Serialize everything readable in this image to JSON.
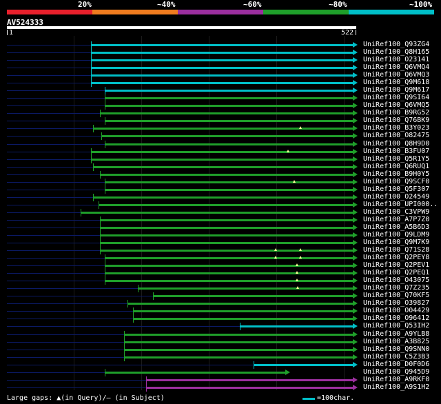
{
  "legend": {
    "labels": [
      "20%",
      "~40%",
      "~60%",
      "~80%",
      "~100%"
    ],
    "colors": [
      "#e8202c",
      "#f07c1f",
      "#9b2f9e",
      "#1f9f2a",
      "#00bfc8"
    ]
  },
  "query": {
    "name": "AV524333",
    "start": "1",
    "end": "522"
  },
  "hits": [
    {
      "name": "UniRef100_Q93ZG4",
      "color": "#00bfc8",
      "gaps": []
    },
    {
      "name": "UniRef100_Q8H165",
      "color": "#00bfc8",
      "gaps": []
    },
    {
      "name": "UniRef100_O23141",
      "color": "#00bfc8",
      "gaps": []
    },
    {
      "name": "UniRef100_Q6VMQ4",
      "color": "#00bfc8",
      "gaps": []
    },
    {
      "name": "UniRef100_Q6VMQ3",
      "color": "#00bfc8",
      "gaps": []
    },
    {
      "name": "UniRef100_Q9M618",
      "color": "#00bfc8",
      "gaps": []
    },
    {
      "name": "UniRef100_Q9M617",
      "color": "#00bfc8",
      "gaps": []
    },
    {
      "name": "UniRef100_Q9SI64",
      "color": "#1f9f2a",
      "gaps": []
    },
    {
      "name": "UniRef100_Q6VMQ5",
      "color": "#1f9f2a",
      "gaps": []
    },
    {
      "name": "UniRef100_B9RG52",
      "color": "#1f9f2a",
      "gaps": []
    },
    {
      "name": "UniRef100_Q76BK9",
      "color": "#1f9f2a",
      "gaps": []
    },
    {
      "name": "UniRef100_B3Y023",
      "color": "#1f9f2a",
      "gaps": [
        436
      ]
    },
    {
      "name": "UniRef100_O82475",
      "color": "#1f9f2a",
      "gaps": []
    },
    {
      "name": "UniRef100_Q8H9D0",
      "color": "#1f9f2a",
      "gaps": []
    },
    {
      "name": "UniRef100_B3FU07",
      "color": "#1f9f2a",
      "gaps": [
        418
      ]
    },
    {
      "name": "UniRef100_Q5R1Y5",
      "color": "#1f9f2a",
      "gaps": []
    },
    {
      "name": "UniRef100_Q6RUQ1",
      "color": "#1f9f2a",
      "gaps": []
    },
    {
      "name": "UniRef100_B9H0Y5",
      "color": "#1f9f2a",
      "gaps": []
    },
    {
      "name": "UniRef100_Q9SCF0",
      "color": "#1f9f2a",
      "gaps": [
        427
      ]
    },
    {
      "name": "UniRef100_Q5F307",
      "color": "#1f9f2a",
      "gaps": []
    },
    {
      "name": "UniRef100_O24549",
      "color": "#1f9f2a",
      "gaps": []
    },
    {
      "name": "UniRef100_UPI000..",
      "color": "#1f9f2a",
      "gaps": []
    },
    {
      "name": "UniRef100_C3VPW9",
      "color": "#1f9f2a",
      "gaps": []
    },
    {
      "name": "UniRef100_A7P7Z0",
      "color": "#1f9f2a",
      "gaps": []
    },
    {
      "name": "UniRef100_A5B6D3",
      "color": "#1f9f2a",
      "gaps": []
    },
    {
      "name": "UniRef100_Q9LDM9",
      "color": "#1f9f2a",
      "gaps": []
    },
    {
      "name": "UniRef100_Q9M7K9",
      "color": "#1f9f2a",
      "gaps": []
    },
    {
      "name": "UniRef100_Q71S28",
      "color": "#1f9f2a",
      "gaps": [
        400,
        436
      ]
    },
    {
      "name": "UniRef100_Q2PEY8",
      "color": "#1f9f2a",
      "gaps": [
        400,
        436
      ]
    },
    {
      "name": "UniRef100_Q2PEV1",
      "color": "#1f9f2a",
      "gaps": [
        431
      ]
    },
    {
      "name": "UniRef100_Q2PEQ1",
      "color": "#1f9f2a",
      "gaps": [
        431
      ]
    },
    {
      "name": "UniRef100_O43075",
      "color": "#1f9f2a",
      "gaps": [
        431
      ]
    },
    {
      "name": "UniRef100_Q7Z235",
      "color": "#1f9f2a",
      "gaps": [
        432
      ]
    },
    {
      "name": "UniRef100_Q70KF5",
      "color": "#1f9f2a",
      "gaps": []
    },
    {
      "name": "UniRef100_O39827",
      "color": "#1f9f2a",
      "gaps": []
    },
    {
      "name": "UniRef100_O04429",
      "color": "#1f9f2a",
      "gaps": []
    },
    {
      "name": "UniRef100_O96412",
      "color": "#1f9f2a",
      "gaps": []
    },
    {
      "name": "UniRef100_Q53IH2",
      "color": "#00bfc8",
      "gaps": []
    },
    {
      "name": "UniRef100_A9YLB8",
      "color": "#1f9f2a",
      "gaps": []
    },
    {
      "name": "UniRef100_A3B825",
      "color": "#1f9f2a",
      "gaps": []
    },
    {
      "name": "UniRef100_Q9SNN0",
      "color": "#1f9f2a",
      "gaps": []
    },
    {
      "name": "UniRef100_C5Z3B3",
      "color": "#1f9f2a",
      "gaps": []
    },
    {
      "name": "UniRef100_D0F0D6",
      "color": "#00bfc8",
      "gaps": []
    },
    {
      "name": "UniRef100_Q945D9",
      "color": "#1f9f2a",
      "gaps": []
    },
    {
      "name": "UniRef100_A9RKF0",
      "color": "#9b2f9e",
      "gaps": []
    },
    {
      "name": "UniRef100_A9S1H2",
      "color": "#9b2f9e",
      "gaps": []
    }
  ],
  "footer": {
    "gaps_label": "Large gaps: ▲(in Query)/– (in Subject)",
    "scale_label": "=100char."
  }
}
